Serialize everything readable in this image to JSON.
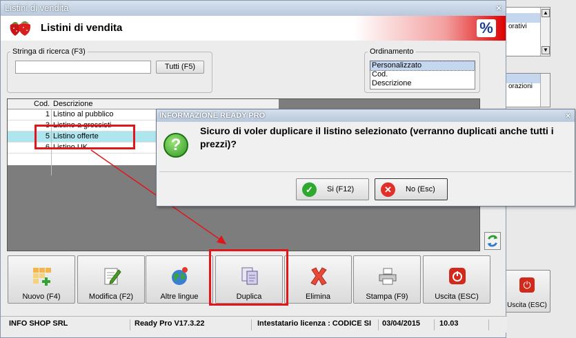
{
  "background_window": {
    "list1_text": "orativi",
    "list2_text": "orazioni",
    "exit_label": "Uscita (ESC)"
  },
  "window": {
    "title": "Listini di vendita",
    "close": "×",
    "header_title": "Listini di vendita",
    "header_badge": "%"
  },
  "search": {
    "legend": "Stringa di ricerca (F3)",
    "value": "",
    "all_button": "Tutti (F5)"
  },
  "ordering": {
    "legend": "Ordinamento",
    "options": [
      "Personalizzato",
      "Cod.",
      "Descrizione"
    ],
    "selected": 0
  },
  "table": {
    "headers": {
      "cod": "Cod.",
      "desc": "Descrizione"
    },
    "rows": [
      {
        "cod": "1",
        "desc": "Listino al pubblico"
      },
      {
        "cod": "3",
        "desc": "Listino a grossisti"
      },
      {
        "cod": "5",
        "desc": "Listino offerte"
      },
      {
        "cod": "6",
        "desc": "Listino UK"
      }
    ],
    "selected_row": 2
  },
  "toolbar": {
    "new": "Nuovo (F4)",
    "edit": "Modifica (F2)",
    "languages": "Altre lingue",
    "duplicate": "Duplica",
    "delete": "Elimina",
    "print": "Stampa (F9)",
    "exit": "Uscita (ESC)"
  },
  "status": {
    "company": "INFO SHOP SRL",
    "version": "Ready Pro V17.3.22",
    "license": "Intestatario licenza : CODICE SI",
    "date": "03/04/2015",
    "time": "10.03"
  },
  "dialog": {
    "title": "INFORMAZIONE READY PRO",
    "close": "×",
    "message": "Sicuro di voler duplicare il listino selezionato (verranno duplicati anche tutti i prezzi)?",
    "yes": "Si (F12)",
    "no": "No (Esc)"
  },
  "colors": {
    "highlight": "#e0161b",
    "selected_row": "#aee6f0"
  }
}
